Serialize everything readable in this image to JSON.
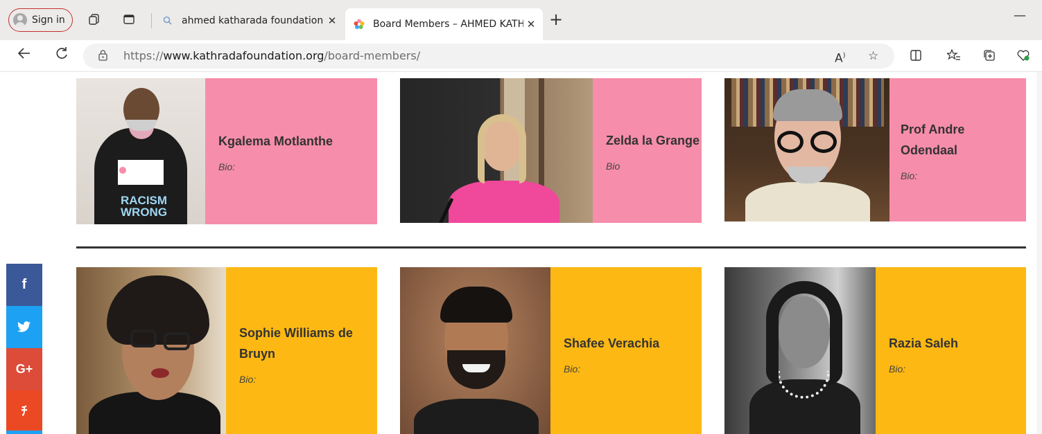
{
  "browser": {
    "signin_label": "Sign in",
    "tabs": [
      {
        "title": "ahmed katharada foundation tru",
        "active": false
      },
      {
        "title": "Board Members – AHMED KATH",
        "active": true
      }
    ],
    "url_prefix": "https://",
    "url_domain": "www.kathradafoundation.org",
    "url_path": "/board-members/"
  },
  "board": {
    "row1": [
      {
        "name": "Kgalema Motlanthe",
        "bio": "Bio:",
        "shirt_text": "RACISM WRONG"
      },
      {
        "name": "Zelda la Grange",
        "bio": "Bio"
      },
      {
        "name": "Prof Andre Odendaal",
        "bio": "Bio:"
      }
    ],
    "row2": [
      {
        "name": "Sophie Williams de Bruyn",
        "bio": "Bio:"
      },
      {
        "name": "Shafee Verachia",
        "bio": "Bio:"
      },
      {
        "name": "Razia Saleh",
        "bio": "Bio:"
      }
    ]
  },
  "social": [
    {
      "icon": "facebook-icon",
      "glyph": "f",
      "color": "#3b5998"
    },
    {
      "icon": "twitter-icon",
      "glyph": "🐦",
      "color": "#1da1f2"
    },
    {
      "icon": "google-plus-icon",
      "glyph": "G+",
      "color": "#dd4b39"
    },
    {
      "icon": "stumbleupon-icon",
      "glyph": "su",
      "color": "#eb4924"
    }
  ],
  "colors": {
    "pink": "#f68dab",
    "yellow": "#fdb813"
  }
}
